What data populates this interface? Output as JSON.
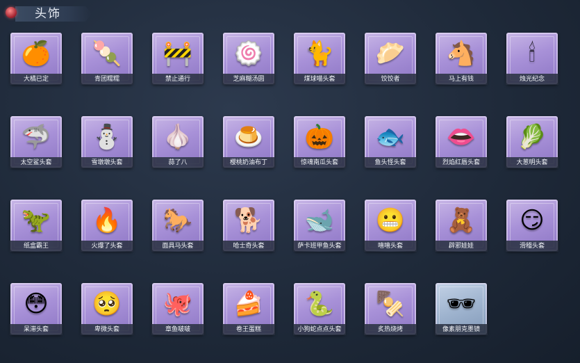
{
  "header": {
    "title": "头饰"
  },
  "items": [
    {
      "label": "大橘已定",
      "icon": "🍊"
    },
    {
      "label": "青团糯糯",
      "icon": "🍡"
    },
    {
      "label": "禁止通行",
      "icon": "🚧"
    },
    {
      "label": "芝麻糊汤圆",
      "icon": "🍥"
    },
    {
      "label": "煤球喵头套",
      "icon": "🐈"
    },
    {
      "label": "饺饺者",
      "icon": "🥟"
    },
    {
      "label": "马上有钱",
      "icon": "🐴"
    },
    {
      "label": "烛光纪念",
      "icon": "🕯"
    },
    {
      "label": "太空鲨头套",
      "icon": "🦈"
    },
    {
      "label": "雪墩墩头套",
      "icon": "⛄"
    },
    {
      "label": "蒜了八",
      "icon": "🧄"
    },
    {
      "label": "樱桃奶油布丁",
      "icon": "🍮"
    },
    {
      "label": "惊魂南瓜头套",
      "icon": "🎃"
    },
    {
      "label": "鱼头怪头套",
      "icon": "🐟"
    },
    {
      "label": "烈焰红唇头套",
      "icon": "👄"
    },
    {
      "label": "大葱明头套",
      "icon": "🥬"
    },
    {
      "label": "纸盒霸王",
      "icon": "🦖"
    },
    {
      "label": "火爆了头套",
      "icon": "🔥"
    },
    {
      "label": "面具马头套",
      "icon": "🐎"
    },
    {
      "label": "哈士奇头套",
      "icon": "🐕"
    },
    {
      "label": "萨卡班甲鱼头套",
      "icon": "🐋"
    },
    {
      "label": "嘻嘻头套",
      "icon": "😬"
    },
    {
      "label": "辟邪娃娃",
      "icon": "🧸"
    },
    {
      "label": "滑稽头套",
      "icon": "😏"
    },
    {
      "label": "呆滞头套",
      "icon": "😳"
    },
    {
      "label": "卑微头套",
      "icon": "🥺"
    },
    {
      "label": "章鱼啵啵",
      "icon": "🐙"
    },
    {
      "label": "卷王蛋糕",
      "icon": "🍰"
    },
    {
      "label": "小狗蛇点点头套",
      "icon": "🐍"
    },
    {
      "label": "炙热烧烤",
      "icon": "🍢"
    },
    {
      "label": "像素朋克墨镜",
      "icon": "🕶"
    }
  ]
}
